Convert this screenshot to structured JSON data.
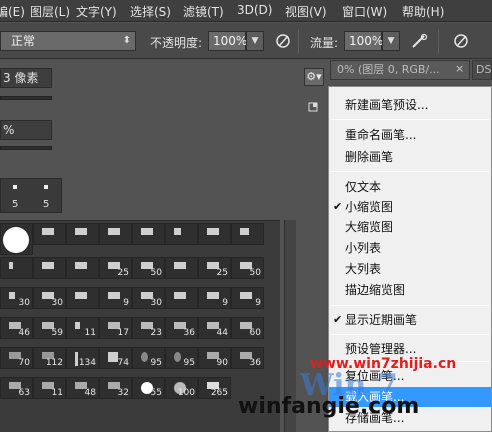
{
  "menubar": {
    "items": [
      {
        "label": "编(E)"
      },
      {
        "label": "图层(L)"
      },
      {
        "label": "文字(Y)"
      },
      {
        "label": "选择(S)"
      },
      {
        "label": "滤镜(T)"
      },
      {
        "label": "3D(D)"
      },
      {
        "label": "视图(V)"
      },
      {
        "label": "窗口(W)"
      },
      {
        "label": "帮助(H)"
      }
    ]
  },
  "options": {
    "mode": "正常",
    "opacity_label": "不透明度:",
    "opacity_value": "100%",
    "flow_label": "流量:",
    "flow_value": "100%",
    "pressure_opacity_icon": "pen-pressure-icon",
    "airbrush_icon": "airbrush-icon",
    "pressure_size_icon": "pen-pressure-size-icon"
  },
  "brush_panel": {
    "size_value": "3 像素",
    "hardness_value": "%",
    "gear_icon": "gear-icon",
    "strip_numbers": [
      "5",
      "5"
    ],
    "grid_numbers": [
      {
        "n": ""
      },
      {
        "n": ""
      },
      {
        "n": ""
      },
      {
        "n": ""
      },
      {
        "n": ""
      },
      {
        "n": ""
      },
      {
        "n": ""
      },
      {
        "n": ""
      },
      {
        "n": ""
      },
      {
        "n": "25"
      },
      {
        "n": "50"
      },
      {
        "n": "25"
      },
      {
        "n": "25"
      },
      {
        "n": "50"
      },
      {
        "n": "30"
      },
      {
        "n": "30"
      },
      {
        "n": ""
      },
      {
        "n": "9"
      },
      {
        "n": "30"
      },
      {
        "n": "9"
      },
      {
        "n": "9"
      },
      {
        "n": "46"
      },
      {
        "n": "59"
      },
      {
        "n": "11"
      },
      {
        "n": "17"
      },
      {
        "n": "23"
      },
      {
        "n": "36"
      },
      {
        "n": "44"
      },
      {
        "n": "70"
      },
      {
        "n": "112"
      },
      {
        "n": "134"
      },
      {
        "n": "74"
      },
      {
        "n": "95"
      },
      {
        "n": "95"
      },
      {
        "n": "90"
      },
      {
        "n": "63"
      },
      {
        "n": "11"
      },
      {
        "n": "48"
      },
      {
        "n": "32"
      },
      {
        "n": "55"
      },
      {
        "n": "100"
      },
      {
        "n": "265"
      }
    ],
    "extra_right": [
      "60",
      "36"
    ]
  },
  "document_tab": {
    "label": "0% (图层 0, RGB/...",
    "close": "×",
    "second_tab": "DS"
  },
  "context_menu": {
    "items": [
      {
        "label": "新建画笔预设..."
      },
      {
        "label": "重命名画笔..."
      },
      {
        "label": "删除画笔"
      },
      {
        "label": "仅文本"
      },
      {
        "label": "小缩览图",
        "checked": true
      },
      {
        "label": "大缩览图"
      },
      {
        "label": "小列表"
      },
      {
        "label": "大列表"
      },
      {
        "label": "描边缩览图"
      },
      {
        "label": "显示近期画笔",
        "checked": true
      },
      {
        "label": "预设管理器..."
      },
      {
        "label": "复位画笔..."
      },
      {
        "label": "载入画笔..."
      },
      {
        "label": "存储画笔..."
      }
    ],
    "check_mark": "✔"
  },
  "watermark": {
    "site_red": "www.win7zhijia.cn",
    "logo": "Win 7",
    "bottom": "winfangie.com"
  }
}
